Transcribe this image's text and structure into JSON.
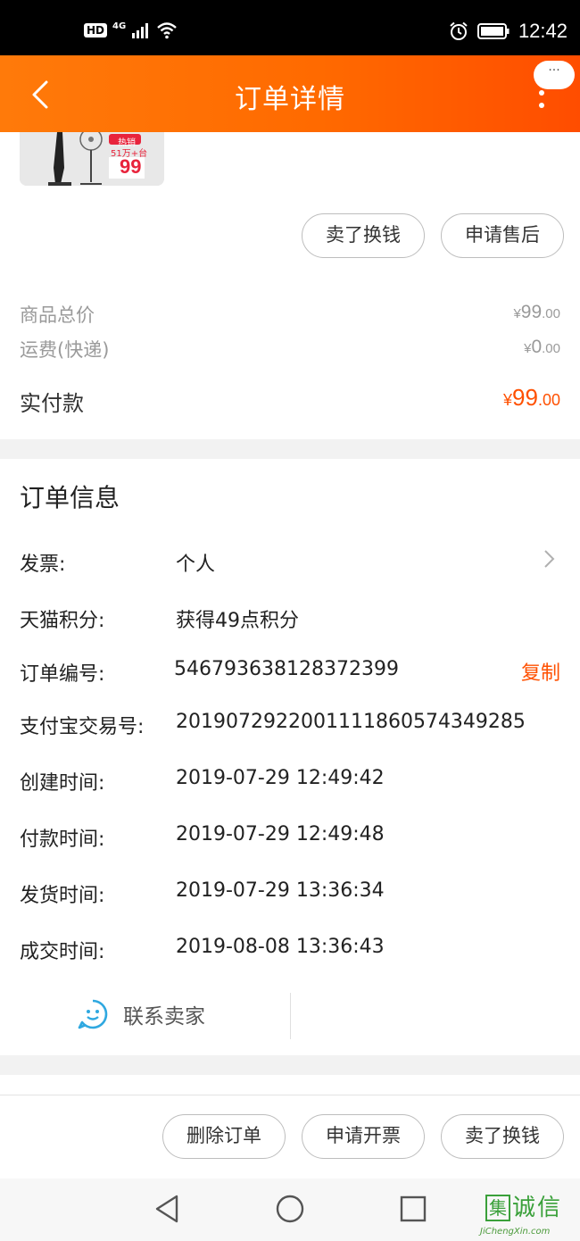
{
  "status_bar": {
    "hd": "HD",
    "network": "4G",
    "time": "12:42"
  },
  "header": {
    "title": "订单详情",
    "message_bubble": "···"
  },
  "product": {
    "badge_top": "热销",
    "badge_sub": "51万+台",
    "price_tag": "99"
  },
  "item_actions": {
    "sell_label": "卖了换钱",
    "after_sale_label": "申请售后"
  },
  "price_summary": {
    "goods_total_label": "商品总价",
    "goods_total_int": "99",
    "goods_total_dec": ".00",
    "shipping_label": "运费(快递)",
    "shipping_int": "0",
    "shipping_dec": ".00",
    "currency": "¥",
    "paid_label": "实付款",
    "paid_int": "99",
    "paid_dec": ".00"
  },
  "order_info": {
    "title": "订单信息",
    "invoice_label": "发票:",
    "invoice_value": "个人",
    "points_label": "天猫积分:",
    "points_value": "获得49点积分",
    "order_no_label": "订单编号:",
    "order_no_value": "546793638128372399",
    "copy_label": "复制",
    "alipay_label": "支付宝交易号:",
    "alipay_value": "2019072922001111860574349285",
    "created_label": "创建时间:",
    "created_value": "2019-07-29 12:49:42",
    "paid_time_label": "付款时间:",
    "paid_time_value": "2019-07-29 12:49:48",
    "shipped_label": "发货时间:",
    "shipped_value": "2019-07-29 13:36:34",
    "closed_label": "成交时间:",
    "closed_value": "2019-08-08 13:36:43",
    "contact_seller": "联系卖家"
  },
  "bottom_actions": {
    "delete_label": "删除订单",
    "invoice_label": "申请开票",
    "sell_label": "卖了换钱"
  },
  "watermark": {
    "chars": "集诚信",
    "site": "JiChengXin.com"
  },
  "colors": {
    "accent": "#ff5000",
    "header_start": "#ff7a0a",
    "header_end": "#ff4d00",
    "contact_icon": "#2fa8e0"
  }
}
